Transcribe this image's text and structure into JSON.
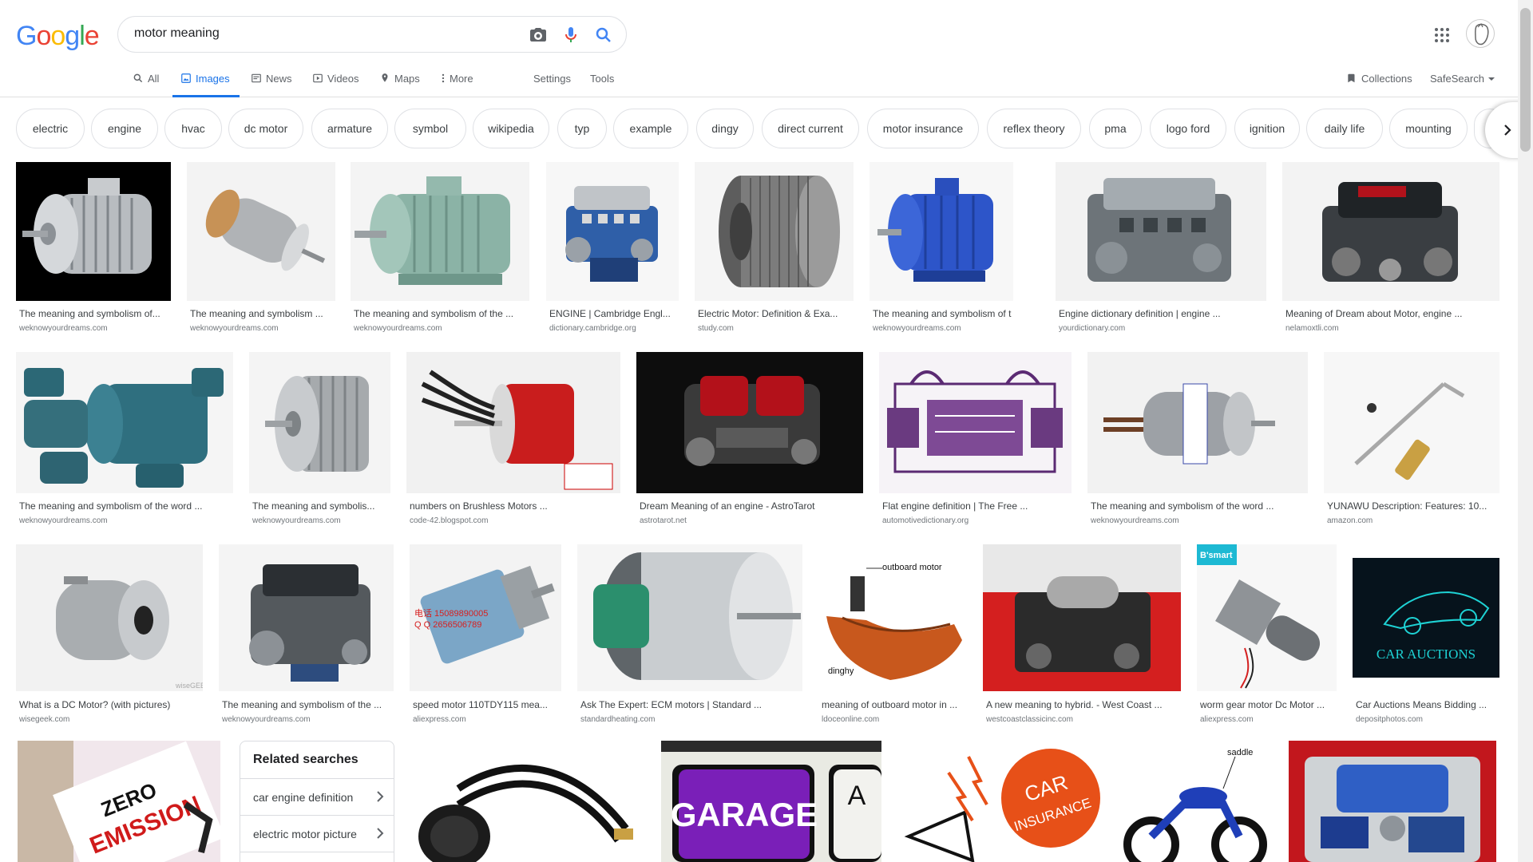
{
  "search": {
    "query": "motor meaning"
  },
  "logo": "Google",
  "tabs": [
    {
      "label": "All",
      "icon": "search-icon"
    },
    {
      "label": "Images",
      "icon": "image-icon",
      "active": true
    },
    {
      "label": "News",
      "icon": "news-icon"
    },
    {
      "label": "Videos",
      "icon": "video-icon"
    },
    {
      "label": "Maps",
      "icon": "map-icon"
    },
    {
      "label": "More",
      "icon": "more-vert-icon"
    },
    {
      "label": "Settings"
    },
    {
      "label": "Tools"
    }
  ],
  "right_tools": {
    "collections": "Collections",
    "safesearch": "SafeSearch"
  },
  "chips": [
    "electric",
    "engine",
    "hvac",
    "dc motor",
    "armature",
    "symbol",
    "wikipedia",
    "typ",
    "example",
    "dingy",
    "direct current",
    "motor insurance",
    "reflex theory",
    "pma",
    "logo ford",
    "ignition",
    "daily life",
    "mounting"
  ],
  "row1": [
    {
      "caption": "The meaning and symbolism of...",
      "source": "weknowyourdreams.com"
    },
    {
      "caption": "The meaning and symbolism ...",
      "source": "weknowyourdreams.com"
    },
    {
      "caption": "The meaning and symbolism of the ...",
      "source": "weknowyourdreams.com"
    },
    {
      "caption": "ENGINE | Cambridge Engl...",
      "source": "dictionary.cambridge.org"
    },
    {
      "caption": "Electric Motor: Definition & Exa...",
      "source": "study.com"
    },
    {
      "caption": "The meaning and symbolism of th...",
      "source": "weknowyourdreams.com"
    },
    {
      "caption": "Engine dictionary definition | engine ...",
      "source": "yourdictionary.com"
    },
    {
      "caption": "Meaning of Dream about Motor, engine ...",
      "source": "nelamoxtli.com"
    }
  ],
  "row2": [
    {
      "caption": "The meaning and symbolism of the word ...",
      "source": "weknowyourdreams.com"
    },
    {
      "caption": "The meaning and symbolis...",
      "source": "weknowyourdreams.com"
    },
    {
      "caption": "numbers on Brushless Motors ...",
      "source": "code-42.blogspot.com"
    },
    {
      "caption": "Dream Meaning of an engine - AstroTarot",
      "source": "astrotarot.net"
    },
    {
      "caption": "Flat engine definition | The Free ...",
      "source": "automotivedictionary.org"
    },
    {
      "caption": "The meaning and symbolism of the word ...",
      "source": "weknowyourdreams.com"
    },
    {
      "caption": "YUNAWU Description: Features: 10...",
      "source": "amazon.com"
    }
  ],
  "row3": [
    {
      "caption": "What is a DC Motor? (with pictures)",
      "source": "wisegeek.com"
    },
    {
      "caption": "The meaning and symbolism of the ...",
      "source": "weknowyourdreams.com"
    },
    {
      "caption": "speed motor 110TDY115 mea...",
      "source": "aliexpress.com"
    },
    {
      "caption": "Ask The Expert: ECM motors | Standard ...",
      "source": "standardheating.com"
    },
    {
      "caption": "meaning of outboard motor in ...",
      "source": "ldoceonline.com"
    },
    {
      "caption": "A new meaning to hybrid. - West Coast ...",
      "source": "westcoastclassicinc.com"
    },
    {
      "caption": "worm gear motor Dc Motor ...",
      "source": "aliexpress.com"
    },
    {
      "caption": "Car Auctions Means Bidding ...",
      "source": "depositphotos.com"
    }
  ],
  "image_text": {
    "outboard": "outboard motor",
    "dinghy": "dinghy",
    "car_auctions": "CAR AUCTIONS",
    "zero": "ZERO",
    "emission": "EMISSION",
    "garage": "GARAGE",
    "garage_a": "A",
    "car": "CAR",
    "insurance": "INSURANCE",
    "saddle": "saddle",
    "smart": "B'smart",
    "wisegeek": "wiseGEEK"
  },
  "related": {
    "title": "Related searches",
    "items": [
      "car engine definition",
      "electric motor picture"
    ]
  },
  "colors": {
    "accent": "#1a73e8",
    "text": "#202124",
    "muted": "#70757a"
  }
}
